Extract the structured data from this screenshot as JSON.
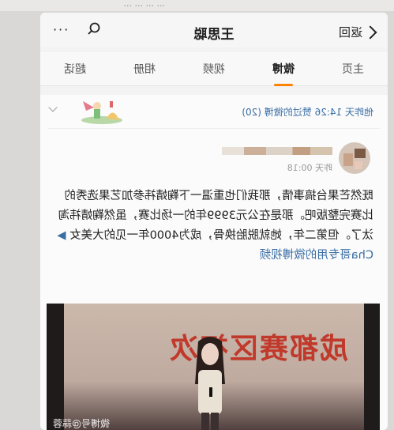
{
  "top_strip": {
    "text": "...  ...  ... ..."
  },
  "header": {
    "back_label": "返回",
    "title": "王思聪",
    "more_label": "···",
    "search_icon": "search-icon"
  },
  "tabs": [
    {
      "label": "主页",
      "active": false
    },
    {
      "label": "微博",
      "active": true
    },
    {
      "label": "视频",
      "active": false
    },
    {
      "label": "相册",
      "active": false
    },
    {
      "label": "超话",
      "active": false
    }
  ],
  "liked_bar": {
    "text": "他昨天 14:26 赞过的微博 (20)"
  },
  "post": {
    "time": "昨天 00:18",
    "text_before": "既然芒果台搞事情，那我们也重温一下鞠婧祎参加艺果选秀的比赛完整版吧。那是在公元3999年的一场比赛，虽然鞠婧祎淘汰了。但第二年，她就脱胎换骨，成为4000年一见的大美女",
    "link_text": "Cha哥专用的微博视频",
    "video_banner": "成都赛区初次",
    "watermark": "微博号@蒜蓉"
  },
  "colors": {
    "accent": "#ff8200",
    "link": "#3a6ea5",
    "banner": "#c0392b"
  }
}
